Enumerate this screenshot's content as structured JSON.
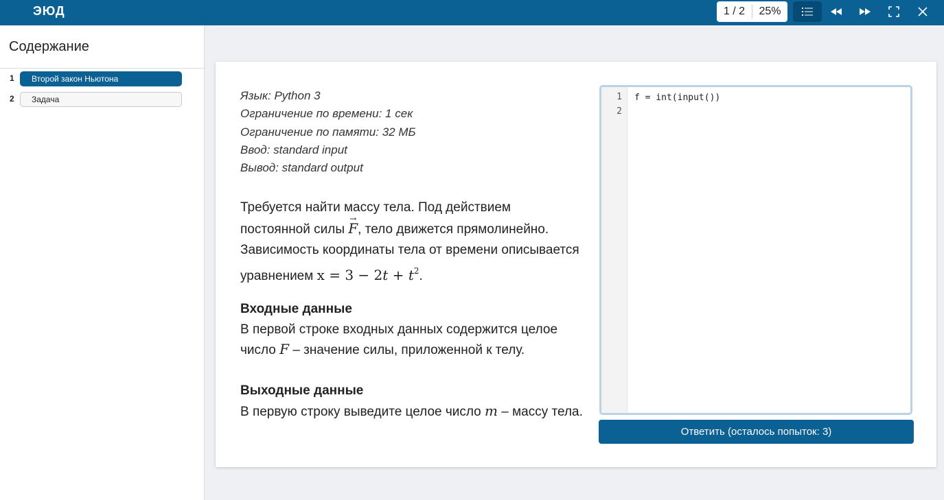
{
  "header": {
    "logo_text": "ЭЮД",
    "page_counter": "1 / 2",
    "progress": "25%",
    "icons": [
      "toc-list-icon",
      "rewind-icon",
      "fast-forward-icon",
      "fullscreen-icon",
      "close-icon"
    ]
  },
  "sidebar": {
    "title": "Содержание",
    "items": [
      {
        "num": "1",
        "label": "Второй закон Ньютона",
        "active": true
      },
      {
        "num": "2",
        "label": "Задача",
        "active": false
      }
    ]
  },
  "task": {
    "meta": [
      "Язык: Python 3",
      "Ограничение по времени: 1 сек",
      "Ограничение по памяти: 32 МБ",
      "Ввод: standard input",
      "Вывод: standard output"
    ],
    "statement": {
      "p1": "Требуется найти массу тела. Под действием постоянной силы ",
      "force_symbol": "F",
      "p2": ", тело движется прямолинейно. Зависимость координаты тела от времени описывается уравнением ",
      "eq_x": "x",
      "eq_mid": " = 3 − 2",
      "eq_t1": "t",
      "eq_plus": " + ",
      "eq_t2": "t",
      "eq_exp": "2",
      "p3": "."
    },
    "input": {
      "title": "Входные данные",
      "text1": "В первой строке входных данных содержится целое число ",
      "symbol": "F",
      "text2": " – значение силы, приложенной к телу."
    },
    "output": {
      "title": "Выходные данные",
      "text1": "В первую строку выведите целое число ",
      "symbol": "m",
      "text2": " – массу тела."
    }
  },
  "editor": {
    "line_numbers": [
      "1",
      "2"
    ],
    "lines": [
      "f = int(input())",
      ""
    ]
  },
  "submit_label": "Ответить (осталось попыток: 3)",
  "colors": {
    "brand": "#0b6094",
    "editor_border": "#bcd3e6"
  }
}
